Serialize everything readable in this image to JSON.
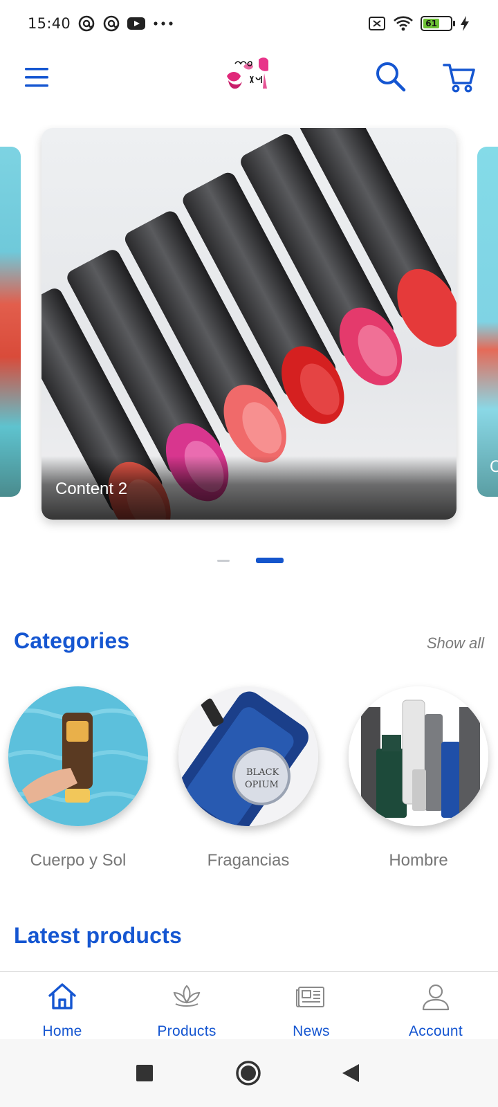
{
  "status_bar": {
    "time": "15:40",
    "left_icons": [
      "at-sign-icon",
      "at-sign-icon",
      "youtube-icon",
      "more-dots-icon"
    ],
    "battery_level": "61",
    "right_icons": [
      "sim-off-icon",
      "wifi-icon",
      "battery-icon",
      "charging-icon"
    ]
  },
  "app_bar": {
    "menu_icon": "hamburger-menu-icon",
    "logo": "mary-kay-logo",
    "search_icon": "search-icon",
    "cart_icon": "cart-icon",
    "accent_color": "#1556d1"
  },
  "carousel": {
    "current_caption": "Content 2",
    "next_caption_partial": "C",
    "active_index": 1,
    "slide_count": 2
  },
  "categories": {
    "title": "Categories",
    "show_all_label": "Show all",
    "items": [
      {
        "label": "Cuerpo y Sol"
      },
      {
        "label": "Fragancias"
      },
      {
        "label": "Hombre"
      }
    ]
  },
  "latest_products": {
    "title": "Latest products"
  },
  "bottom_nav": {
    "items": [
      {
        "label": "Home",
        "icon": "home-icon",
        "active": true
      },
      {
        "label": "Products",
        "icon": "lotus-icon",
        "active": false
      },
      {
        "label": "News",
        "icon": "newspaper-icon",
        "active": false
      },
      {
        "label": "Account",
        "icon": "user-icon",
        "active": false
      }
    ]
  },
  "system_nav": {
    "buttons": [
      "recents-square-icon",
      "home-circle-icon",
      "back-triangle-icon"
    ]
  }
}
